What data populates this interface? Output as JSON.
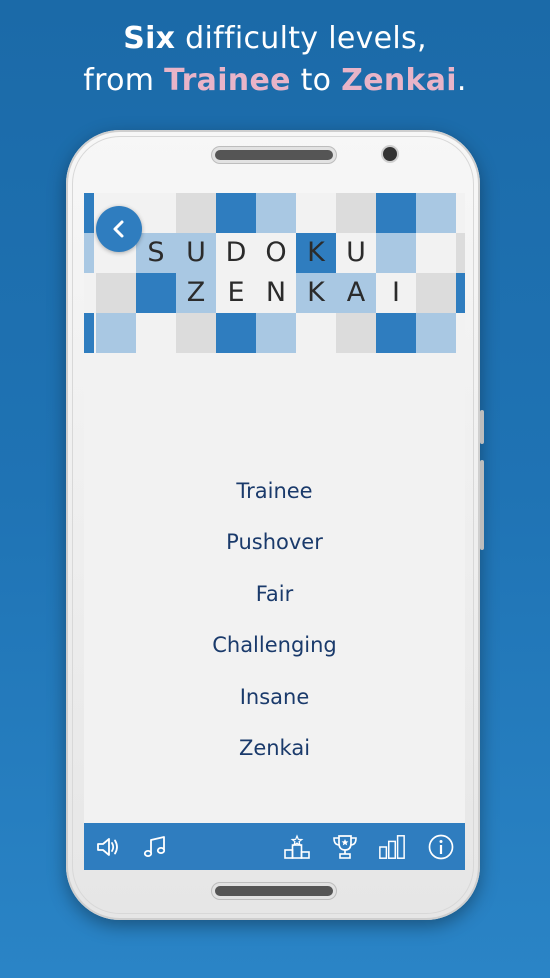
{
  "headline": {
    "line1_bold": "Six",
    "line1_rest": " difficulty levels,",
    "line2_prefix": "from ",
    "line2_level_a": "Trainee",
    "line2_mid": " to ",
    "line2_level_b": "Zenkai",
    "line2_suffix": "."
  },
  "app": {
    "title_row1": [
      "S",
      "U",
      "D",
      "O",
      "K",
      "U"
    ],
    "title_row2": [
      "Z",
      "E",
      "N",
      "K",
      "A",
      "I"
    ],
    "back_icon": "chevron-left-icon",
    "levels": [
      "Trainee",
      "Pushover",
      "Fair",
      "Challenging",
      "Insane",
      "Zenkai"
    ],
    "bottom_bar": {
      "left_icons": [
        "speaker-icon",
        "music-note-icon"
      ],
      "right_icons": [
        "podium-icon",
        "trophy-icon",
        "bar-chart-icon",
        "info-icon"
      ]
    }
  },
  "colors": {
    "background": "#1f73b4",
    "accent_blue": "#2f7dbf",
    "light_blue": "#a9c8e3",
    "pink_highlight": "#e8b4c8",
    "level_text": "#1a3a6b"
  }
}
